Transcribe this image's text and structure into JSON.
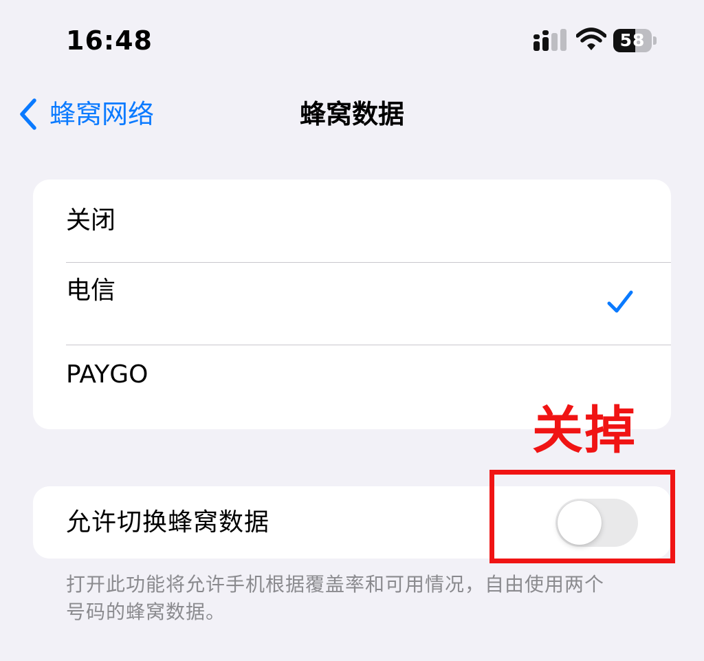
{
  "status_bar": {
    "time": "16:48",
    "battery_text": "58",
    "battery_level": 0.58,
    "signal_icon": "cellular-signal-icon",
    "wifi_icon": "wifi-icon",
    "battery_icon": "battery-icon"
  },
  "nav": {
    "back_label": "蜂窝网络",
    "back_icon": "chevron-left-icon",
    "title": "蜂窝数据"
  },
  "carrier_options": [
    {
      "label": "关闭",
      "selected": false
    },
    {
      "label": "电信",
      "selected": true
    },
    {
      "label": "PAYGO",
      "selected": false
    }
  ],
  "switch_row": {
    "label": "允许切换蜂窝数据",
    "state": "off"
  },
  "footer_note": "打开此功能将允许手机根据覆盖率和可用情况，自由使用两个号码的蜂窝数据。",
  "annotation": {
    "text": "关掉",
    "color": "#f01414"
  },
  "colors": {
    "accent": "#0a7aff",
    "background": "#f2f1f7",
    "card": "#ffffff",
    "toggle_off": "#e9e9ea"
  }
}
